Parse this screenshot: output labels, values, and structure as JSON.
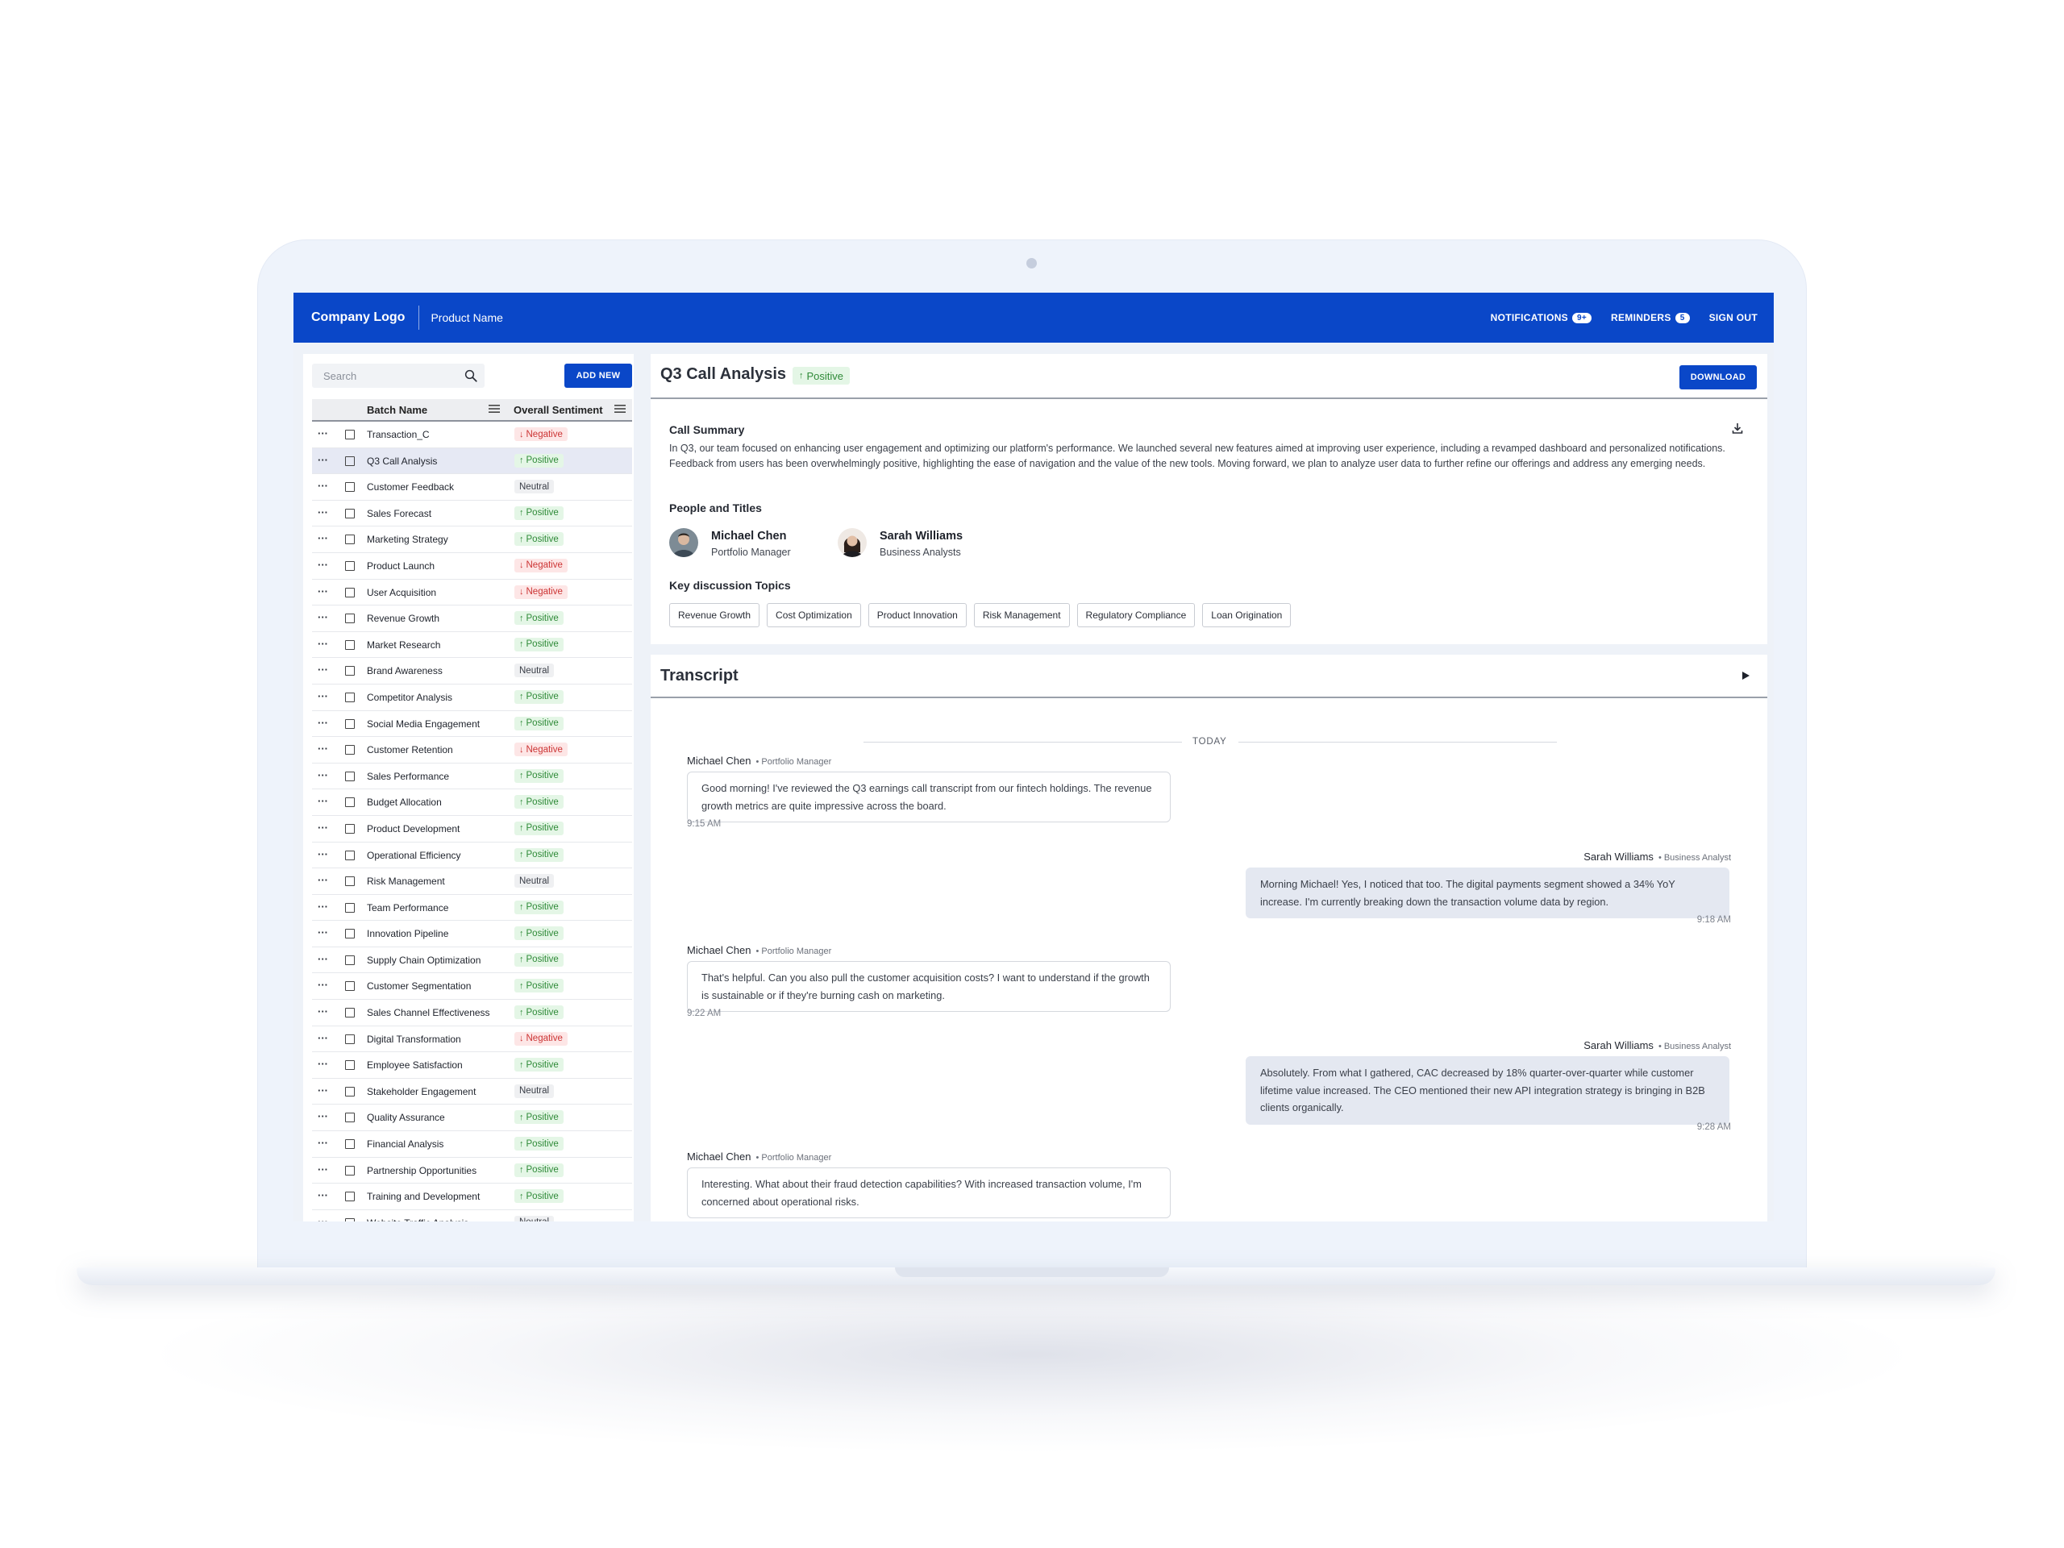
{
  "app": {
    "company_logo": "Company Logo",
    "product_name": "Product Name",
    "notifications_label": "NOTIFICATIONS",
    "notifications_count": "9+",
    "reminders_label": "REMINDERS",
    "reminders_count": "5",
    "sign_out_label": "SIGN OUT"
  },
  "sidebar": {
    "search_placeholder": "Search",
    "add_new_label": "ADD NEW",
    "columns": {
      "batch_name": "Batch Name",
      "overall_sentiment": "Overall Sentiment"
    },
    "rows": [
      {
        "name": "Transaction_C",
        "sentiment": "Negative"
      },
      {
        "name": "Q3 Call Analysis",
        "sentiment": "Positive"
      },
      {
        "name": "Customer Feedback",
        "sentiment": "Neutral"
      },
      {
        "name": "Sales Forecast",
        "sentiment": "Positive"
      },
      {
        "name": "Marketing Strategy",
        "sentiment": "Positive"
      },
      {
        "name": "Product Launch",
        "sentiment": "Negative"
      },
      {
        "name": "User Acquisition",
        "sentiment": "Negative"
      },
      {
        "name": "Revenue Growth",
        "sentiment": "Positive"
      },
      {
        "name": "Market Research",
        "sentiment": "Positive"
      },
      {
        "name": "Brand Awareness",
        "sentiment": "Neutral"
      },
      {
        "name": "Competitor Analysis",
        "sentiment": "Positive"
      },
      {
        "name": "Social Media Engagement",
        "sentiment": "Positive"
      },
      {
        "name": "Customer Retention",
        "sentiment": "Negative"
      },
      {
        "name": "Sales Performance",
        "sentiment": "Positive"
      },
      {
        "name": "Budget Allocation",
        "sentiment": "Positive"
      },
      {
        "name": "Product Development",
        "sentiment": "Positive"
      },
      {
        "name": "Operational Efficiency",
        "sentiment": "Positive"
      },
      {
        "name": "Risk Management",
        "sentiment": "Neutral"
      },
      {
        "name": "Team Performance",
        "sentiment": "Positive"
      },
      {
        "name": "Innovation Pipeline",
        "sentiment": "Positive"
      },
      {
        "name": "Supply Chain Optimization",
        "sentiment": "Positive"
      },
      {
        "name": "Customer Segmentation",
        "sentiment": "Positive"
      },
      {
        "name": "Sales Channel Effectiveness",
        "sentiment": "Positive"
      },
      {
        "name": "Digital Transformation",
        "sentiment": "Negative"
      },
      {
        "name": "Employee Satisfaction",
        "sentiment": "Positive"
      },
      {
        "name": "Stakeholder Engagement",
        "sentiment": "Neutral"
      },
      {
        "name": "Quality Assurance",
        "sentiment": "Positive"
      },
      {
        "name": "Financial Analysis",
        "sentiment": "Positive"
      },
      {
        "name": "Partnership Opportunities",
        "sentiment": "Positive"
      },
      {
        "name": "Training and Development",
        "sentiment": "Positive"
      },
      {
        "name": "Website Traffic Analysis",
        "sentiment": "Neutral"
      }
    ],
    "selected_row": "Q3 Call Analysis"
  },
  "main": {
    "title": "Q3 Call Analysis",
    "title_sentiment": "Positive",
    "download_label": "DOWNLOAD",
    "call_summary_label": "Call Summary",
    "call_summary_text": "In Q3, our team focused on enhancing user engagement and optimizing our platform's performance. We launched several new features aimed at improving user experience, including a revamped dashboard and personalized notifications. Feedback from users has been overwhelmingly positive, highlighting the ease of navigation and the value of the new tools. Moving forward, we plan to analyze user data to further refine our offerings and address any emerging needs.",
    "people_label": "People and Titles",
    "people": [
      {
        "name": "Michael Chen",
        "title": "Portfolio Manager"
      },
      {
        "name": "Sarah Williams",
        "title": "Business Analysts"
      }
    ],
    "topics_label": "Key discussion Topics",
    "topics": [
      "Revenue Growth",
      "Cost Optimization",
      "Product Innovation",
      "Risk Management",
      "Regulatory Compliance",
      "Loan Origination"
    ]
  },
  "transcript": {
    "title": "Transcript",
    "today_label": "TODAY",
    "messages": [
      {
        "speaker": "Michael Chen",
        "role": "• Portfolio Manager",
        "text": "Good morning! I've reviewed the Q3 earnings call transcript from our fintech holdings. The revenue growth metrics are quite impressive across the board.",
        "time": "9:15 AM"
      },
      {
        "speaker": "Sarah Williams",
        "role": "• Business Analyst",
        "text": "Morning Michael! Yes, I noticed that too. The digital payments segment showed a 34% YoY increase. I'm currently breaking down the transaction volume data by region.",
        "time": "9:18 AM"
      },
      {
        "speaker": "Michael Chen",
        "role": "• Portfolio Manager",
        "text": "That's helpful. Can you also pull the customer acquisition costs? I want to understand if the growth is sustainable or if they're burning cash on marketing.",
        "time": "9:22 AM"
      },
      {
        "speaker": "Sarah Williams",
        "role": "• Business Analyst",
        "text": "Absolutely. From what I gathered, CAC decreased by 18% quarter-over-quarter while customer lifetime value increased. The CEO mentioned their new API integration strategy is bringing in B2B clients organically.",
        "time": "9:28 AM"
      },
      {
        "speaker": "Michael Chen",
        "role": "• Portfolio Manager",
        "text": "Interesting. What about their fraud detection capabilities? With increased transaction volume, I'm concerned about operational risks.",
        "time": ""
      }
    ]
  },
  "colors": {
    "brand_blue": "#0a47c8",
    "positive": "#2f8a38",
    "negative": "#cc3434"
  }
}
